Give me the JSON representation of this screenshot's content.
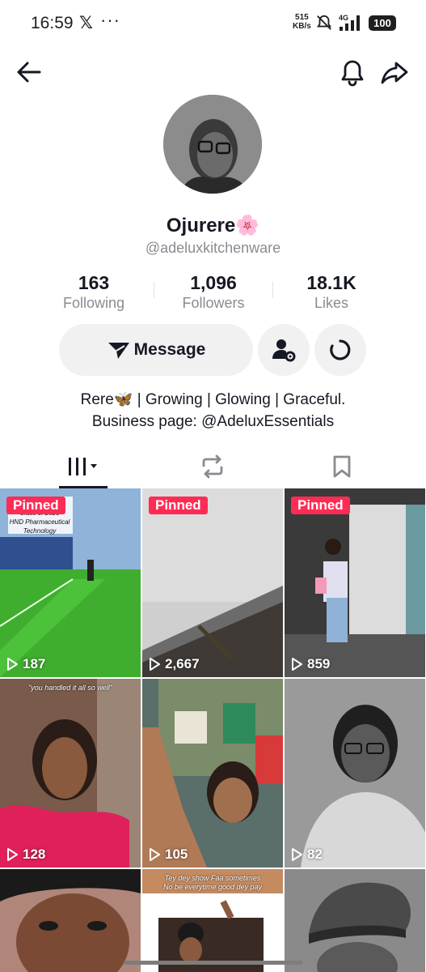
{
  "status_bar": {
    "time": "16:59",
    "x_app": "𝕏",
    "more": "···",
    "speed_value": "515",
    "speed_unit": "KB/s",
    "network": "4G",
    "battery": "100"
  },
  "nav": {
    "back_icon": "arrow-left-icon",
    "bell_icon": "bell-icon",
    "share_icon": "share-arrow-icon"
  },
  "profile": {
    "display_name": "Ojurere🌸",
    "username": "@adeluxkitchenware",
    "stats": [
      {
        "value": "163",
        "label": "Following"
      },
      {
        "value": "1,096",
        "label": "Followers"
      },
      {
        "value": "18.1K",
        "label": "Likes"
      }
    ],
    "message_label": "Message",
    "bio_line1": "Rere🦋 | Growing  | Glowing | Graceful.",
    "bio_line2": "Business page: @AdeluxEssentials"
  },
  "tabs": [
    {
      "icon": "videos-grid-icon",
      "active": true
    },
    {
      "icon": "repost-icon",
      "active": false
    },
    {
      "icon": "bookmark-icon",
      "active": false
    }
  ],
  "videos": [
    {
      "pinned": "Pinned",
      "views": "187",
      "caption": "POLY\nClass of 2026\nHND Pharmaceutical\nTechnology"
    },
    {
      "pinned": "Pinned",
      "views": "2,667",
      "caption": ""
    },
    {
      "pinned": "Pinned",
      "views": "859",
      "caption": ""
    },
    {
      "pinned": "",
      "views": "128",
      "caption": "\"you handled it all so well\""
    },
    {
      "pinned": "",
      "views": "105",
      "caption": ""
    },
    {
      "pinned": "",
      "views": "82",
      "caption": ""
    },
    {
      "pinned": "",
      "views": "",
      "caption": ""
    },
    {
      "pinned": "",
      "views": "",
      "caption": "Tey dey show Faa sometimes\nNo be everytime good dey pay"
    },
    {
      "pinned": "",
      "views": "",
      "caption": ""
    }
  ],
  "colors": {
    "pinned_badge": "#fe2c55",
    "text_primary": "#161823",
    "text_secondary": "#8a8b91",
    "button_bg": "#f1f1f2"
  }
}
